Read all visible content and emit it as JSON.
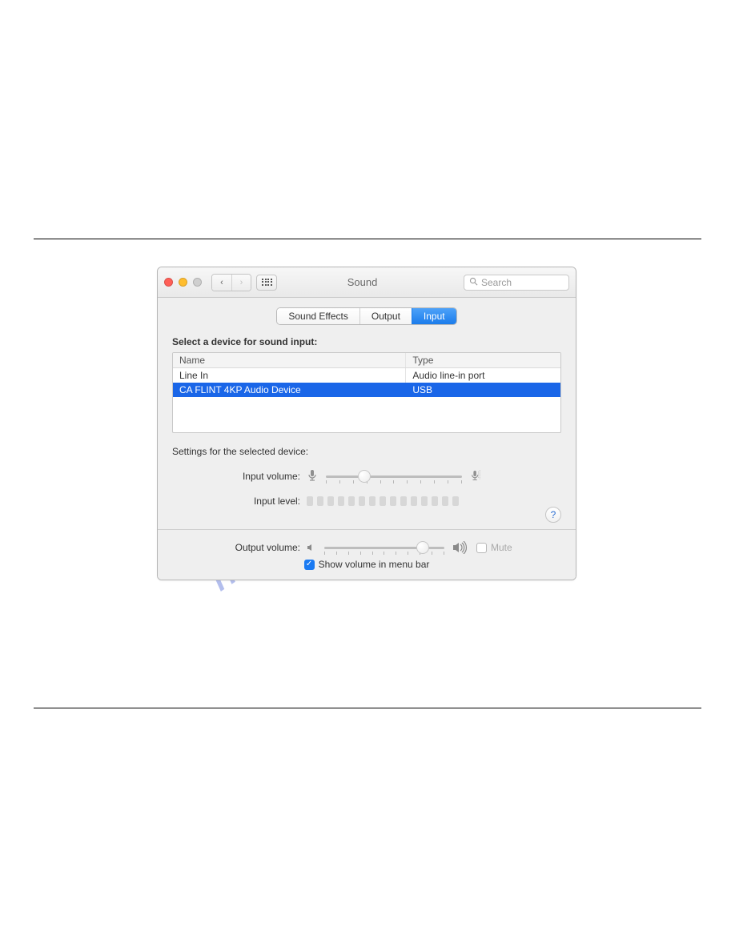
{
  "window": {
    "title": "Sound",
    "search_placeholder": "Search"
  },
  "tabs": {
    "sound_effects": "Sound Effects",
    "output": "Output",
    "input": "Input"
  },
  "input_section": {
    "heading": "Select a device for sound input:",
    "columns": {
      "name": "Name",
      "type": "Type"
    },
    "rows": [
      {
        "name": "Line In",
        "type": "Audio line-in port"
      },
      {
        "name": "CA FLINT 4KP Audio Device",
        "type": "USB"
      }
    ]
  },
  "settings": {
    "heading": "Settings for the selected device:",
    "input_volume_label": "Input volume:",
    "input_volume_pct": 28,
    "input_level_label": "Input level:"
  },
  "output": {
    "label": "Output volume:",
    "volume_pct": 82,
    "mute_label": "Mute",
    "show_menu_label": "Show volume in menu bar"
  },
  "watermark": "manualshive.com"
}
